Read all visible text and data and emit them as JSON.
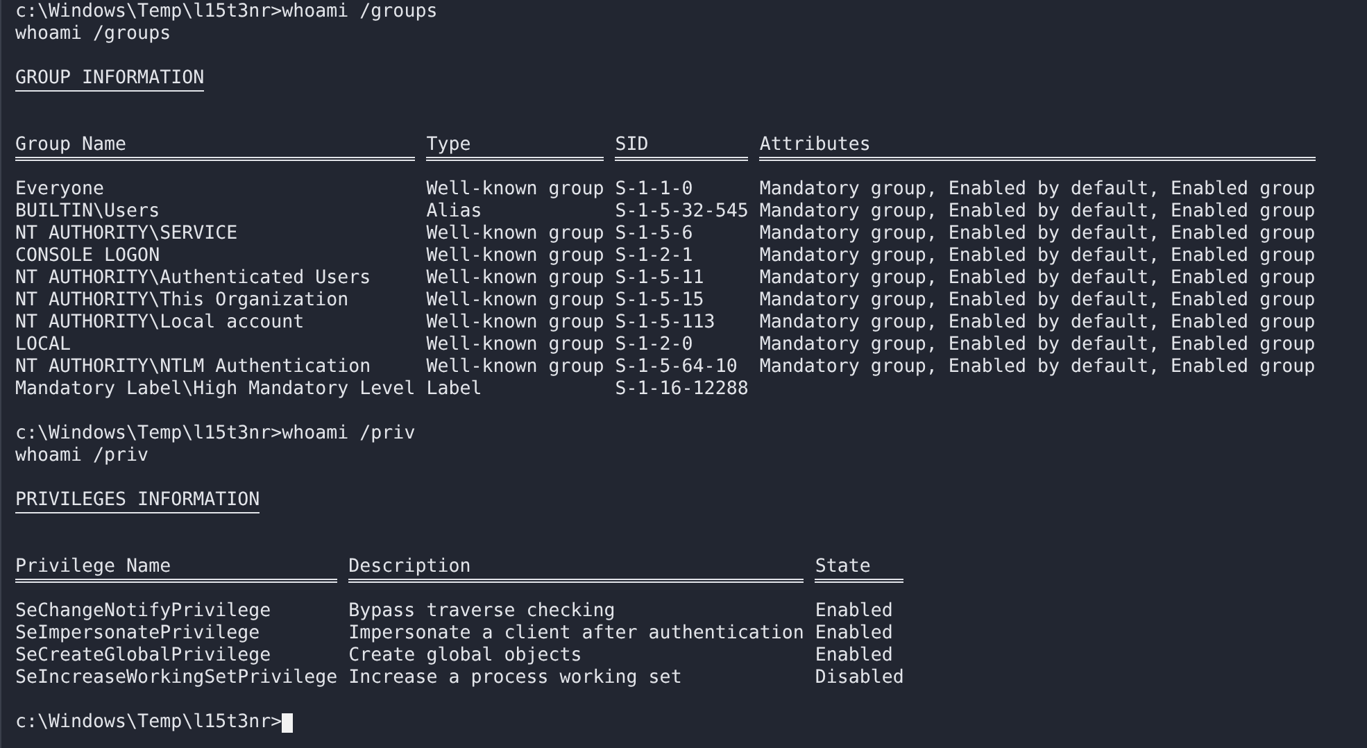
{
  "groups_command": {
    "input": "c:\\Windows\\Temp\\l15t3nr>whoami /groups",
    "echo": "whoami /groups"
  },
  "group_info": {
    "title": "GROUP INFORMATION",
    "columns": [
      "Group Name",
      "Type",
      "SID",
      "Attributes"
    ],
    "rows": [
      [
        "Everyone",
        "Well-known group",
        "S-1-1-0",
        "Mandatory group, Enabled by default, Enabled group"
      ],
      [
        "BUILTIN\\Users",
        "Alias",
        "S-1-5-32-545",
        "Mandatory group, Enabled by default, Enabled group"
      ],
      [
        "NT AUTHORITY\\SERVICE",
        "Well-known group",
        "S-1-5-6",
        "Mandatory group, Enabled by default, Enabled group"
      ],
      [
        "CONSOLE LOGON",
        "Well-known group",
        "S-1-2-1",
        "Mandatory group, Enabled by default, Enabled group"
      ],
      [
        "NT AUTHORITY\\Authenticated Users",
        "Well-known group",
        "S-1-5-11",
        "Mandatory group, Enabled by default, Enabled group"
      ],
      [
        "NT AUTHORITY\\This Organization",
        "Well-known group",
        "S-1-5-15",
        "Mandatory group, Enabled by default, Enabled group"
      ],
      [
        "NT AUTHORITY\\Local account",
        "Well-known group",
        "S-1-5-113",
        "Mandatory group, Enabled by default, Enabled group"
      ],
      [
        "LOCAL",
        "Well-known group",
        "S-1-2-0",
        "Mandatory group, Enabled by default, Enabled group"
      ],
      [
        "NT AUTHORITY\\NTLM Authentication",
        "Well-known group",
        "S-1-5-64-10",
        "Mandatory group, Enabled by default, Enabled group"
      ],
      [
        "Mandatory Label\\High Mandatory Level",
        "Label",
        "S-1-16-12288",
        ""
      ]
    ]
  },
  "privileges_command": {
    "input": "c:\\Windows\\Temp\\l15t3nr>whoami /priv",
    "echo": "whoami /priv"
  },
  "privileges_info": {
    "title": "PRIVILEGES INFORMATION",
    "columns": [
      "Privilege Name",
      "Description",
      "State"
    ],
    "rows": [
      [
        "SeChangeNotifyPrivilege",
        "Bypass traverse checking",
        "Enabled"
      ],
      [
        "SeImpersonatePrivilege",
        "Impersonate a client after authentication",
        "Enabled"
      ],
      [
        "SeCreateGlobalPrivilege",
        "Create global objects",
        "Enabled"
      ],
      [
        "SeIncreaseWorkingSetPrivilege",
        "Increase a process working set",
        "Disabled"
      ]
    ]
  },
  "final_prompt": {
    "input": "c:\\Windows\\Temp\\l15t3nr>"
  }
}
